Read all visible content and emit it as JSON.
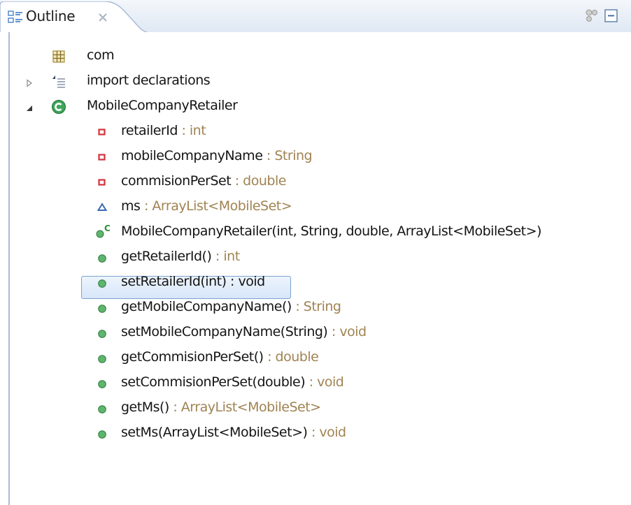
{
  "tab": {
    "title": "Outline",
    "close_glyph": "✕"
  },
  "toolbar": {
    "sync_icon": "sort-members-icon",
    "collapse_icon": "collapse-all-icon"
  },
  "colors": {
    "name": "#141414",
    "type": "#a08352",
    "method": "#2f9e41",
    "field_private": "#d2323c",
    "field_default": "#3b6bb4"
  },
  "tree": [
    {
      "name": "com",
      "type": "",
      "icon": "package-icon",
      "twisty": "none"
    },
    {
      "name": "import declarations",
      "type": "",
      "icon": "imports-icon",
      "twisty": "collapsed"
    },
    {
      "name": "MobileCompanyRetailer",
      "type": "",
      "icon": "class-icon",
      "twisty": "expanded"
    },
    {
      "name": "retailerId",
      "type": " : int",
      "icon": "private-field-icon",
      "twisty": "none"
    },
    {
      "name": "mobileCompanyName",
      "type": " : String",
      "icon": "private-field-icon",
      "twisty": "none"
    },
    {
      "name": "commisionPerSet",
      "type": " : double",
      "icon": "private-field-icon",
      "twisty": "none"
    },
    {
      "name": "ms",
      "type": " : ArrayList<MobileSet>",
      "icon": "default-field-icon",
      "twisty": "none"
    },
    {
      "name": "MobileCompanyRetailer(int, String, double, ArrayList<MobileSet>)",
      "type": "",
      "icon": "constructor-icon",
      "twisty": "none"
    },
    {
      "name": "getRetailerId()",
      "type": " : int",
      "icon": "public-method-icon",
      "twisty": "none"
    },
    {
      "name": "setRetailerId(int) : void",
      "type": "",
      "icon": "public-method-icon",
      "twisty": "none",
      "selected": true
    },
    {
      "name": "getMobileCompanyName()",
      "type": " : String",
      "icon": "public-method-icon",
      "twisty": "none"
    },
    {
      "name": "setMobileCompanyName(String)",
      "type": " : void",
      "icon": "public-method-icon",
      "twisty": "none"
    },
    {
      "name": "getCommisionPerSet()",
      "type": " : double",
      "icon": "public-method-icon",
      "twisty": "none"
    },
    {
      "name": "setCommisionPerSet(double)",
      "type": " : void",
      "icon": "public-method-icon",
      "twisty": "none"
    },
    {
      "name": "getMs()",
      "type": " : ArrayList<MobileSet>",
      "icon": "public-method-icon",
      "twisty": "none"
    },
    {
      "name": "setMs(ArrayList<MobileSet>)",
      "type": " : void",
      "icon": "public-method-icon",
      "twisty": "none"
    }
  ]
}
